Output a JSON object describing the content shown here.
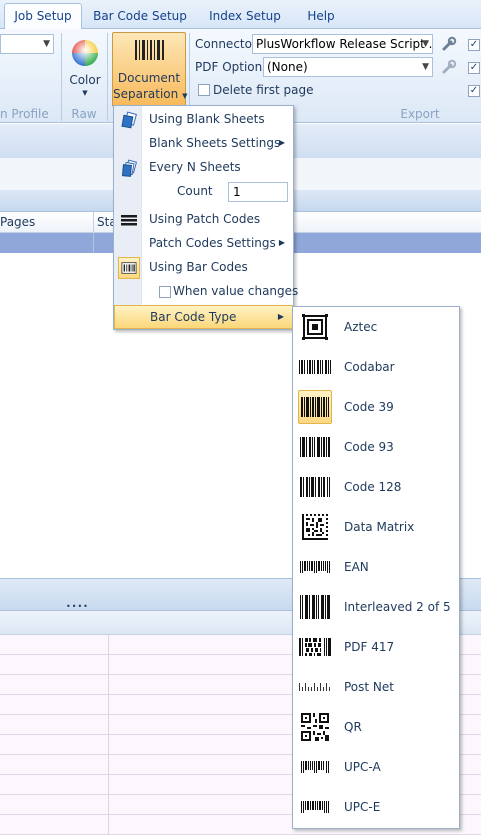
{
  "tabs": [
    {
      "label": "Job Setup",
      "active": true
    },
    {
      "label": "Bar Code Setup",
      "active": false
    },
    {
      "label": "Index Setup",
      "active": false
    },
    {
      "label": "Help",
      "active": false
    }
  ],
  "ribbon": {
    "profile_group_label": "n Profile",
    "color_button_label": "Color",
    "raw_group_label": "Raw",
    "doc_sep_line1": "Document",
    "doc_sep_line2": "Separation",
    "connector_label": "Connector",
    "connector_value": "PlusWorkflow Release Script ...",
    "pdf_options_label": "PDF Options",
    "pdf_options_value": "(None)",
    "delete_first_page_label": "Delete first page",
    "export_group_label": "Export"
  },
  "grid": {
    "col_pages": "Pages",
    "col_status": "Sta"
  },
  "context_menu": {
    "items": [
      {
        "label": "Using Blank Sheets",
        "icon": "blank-sheets-icon"
      },
      {
        "label": "Blank Sheets Settings",
        "submenu": true
      },
      {
        "label": "Every N Sheets",
        "icon": "every-n-sheets-icon"
      },
      {
        "label": "Count",
        "input_value": "1"
      },
      {
        "label": "Using Patch Codes",
        "icon": "patch-codes-icon"
      },
      {
        "label": "Patch Codes Settings",
        "submenu": true
      },
      {
        "label": "Using Bar Codes",
        "icon": "bar-codes-icon",
        "checked": true
      },
      {
        "label": "When value changes",
        "checkbox": true
      },
      {
        "label": "Bar Code Type",
        "submenu": true,
        "highlighted": true
      }
    ]
  },
  "barcode_types": [
    {
      "label": "Aztec",
      "icon": "aztec-icon"
    },
    {
      "label": "Codabar",
      "icon": "codabar-icon"
    },
    {
      "label": "Code 39",
      "icon": "code39-icon",
      "selected": true
    },
    {
      "label": "Code 93",
      "icon": "code93-icon"
    },
    {
      "label": "Code 128",
      "icon": "code128-icon"
    },
    {
      "label": "Data Matrix",
      "icon": "data-matrix-icon"
    },
    {
      "label": "EAN",
      "icon": "ean-icon"
    },
    {
      "label": "Interleaved 2 of 5",
      "icon": "interleaved-2of5-icon"
    },
    {
      "label": "PDF 417",
      "icon": "pdf417-icon"
    },
    {
      "label": "Post Net",
      "icon": "postnet-icon"
    },
    {
      "label": "QR",
      "icon": "qr-icon"
    },
    {
      "label": "UPC-A",
      "icon": "upca-icon"
    },
    {
      "label": "UPC-E",
      "icon": "upce-icon"
    }
  ],
  "colors": {
    "accent": "#15428b",
    "highlight": "#fbd77a",
    "ribbon": "#dce8f6",
    "selected_row": "#8fa7d9"
  }
}
